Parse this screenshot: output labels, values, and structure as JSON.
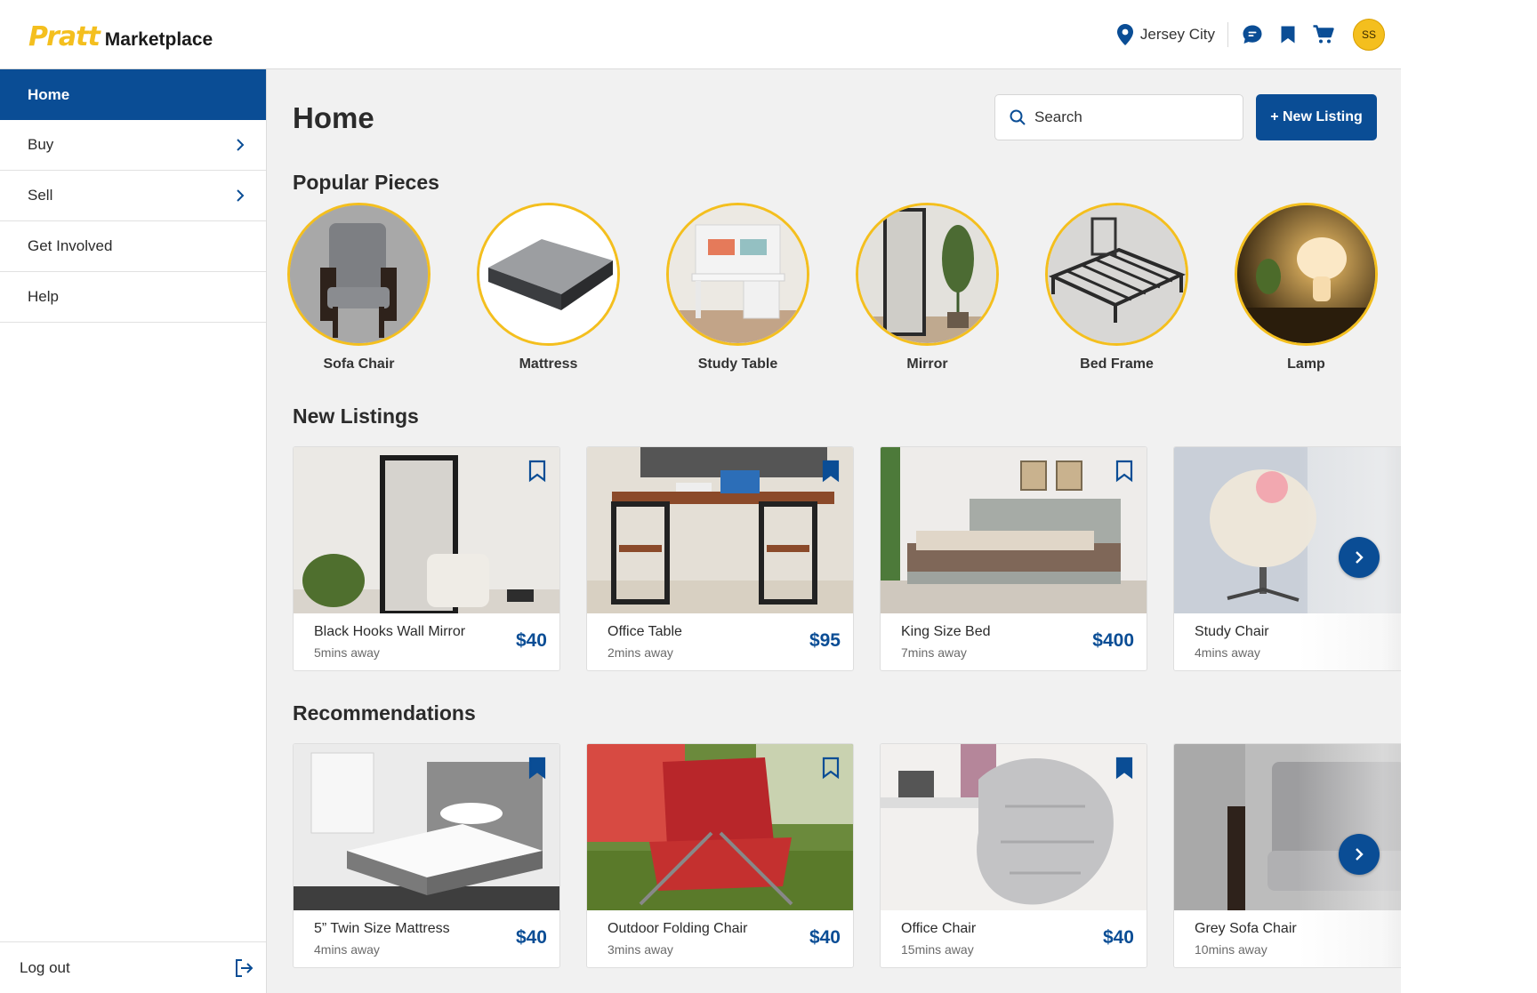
{
  "brand": {
    "name_primary": "Pratt",
    "name_secondary": "Marketplace",
    "accent": "#f4bf1e",
    "primary": "#0a4d95"
  },
  "header": {
    "location": "Jersey City",
    "icons": [
      "location-pin-icon",
      "chat-icon",
      "bookmark-icon",
      "cart-icon"
    ],
    "avatar_initials": "SS"
  },
  "sidebar": {
    "items": [
      {
        "label": "Home",
        "active": true
      },
      {
        "label": "Buy",
        "has_chevron": true
      },
      {
        "label": "Sell",
        "has_chevron": true
      },
      {
        "label": "Get Involved"
      },
      {
        "label": "Help"
      }
    ],
    "logout_label": "Log out"
  },
  "main": {
    "title": "Home",
    "search_placeholder": "Search",
    "new_listing_label": "+ New Listing",
    "popular": {
      "title": "Popular Pieces",
      "items": [
        "Sofa Chair",
        "Mattress",
        "Study Table",
        "Mirror",
        "Bed Frame",
        "Lamp"
      ]
    },
    "new_listings": {
      "title": "New Listings",
      "items": [
        {
          "name": "Black Hooks Wall Mirror",
          "distance": "5mins away",
          "price": "$40",
          "bookmarked": false
        },
        {
          "name": "Office Table",
          "distance": "2mins away",
          "price": "$95",
          "bookmarked": true
        },
        {
          "name": "King Size Bed",
          "distance": "7mins away",
          "price": "$400",
          "bookmarked": false
        },
        {
          "name": "Study Chair",
          "distance": "4mins away",
          "price": "$",
          "bookmarked": false
        }
      ]
    },
    "recommendations": {
      "title": "Recommendations",
      "items": [
        {
          "name": "5” Twin Size Mattress",
          "distance": "4mins away",
          "price": "$40",
          "bookmarked": true
        },
        {
          "name": "Outdoor Folding Chair",
          "distance": "3mins away",
          "price": "$40",
          "bookmarked": false
        },
        {
          "name": "Office Chair",
          "distance": "15mins away",
          "price": "$40",
          "bookmarked": true
        },
        {
          "name": "Grey Sofa Chair",
          "distance": "10mins away",
          "price": "$",
          "bookmarked": false
        }
      ]
    }
  }
}
